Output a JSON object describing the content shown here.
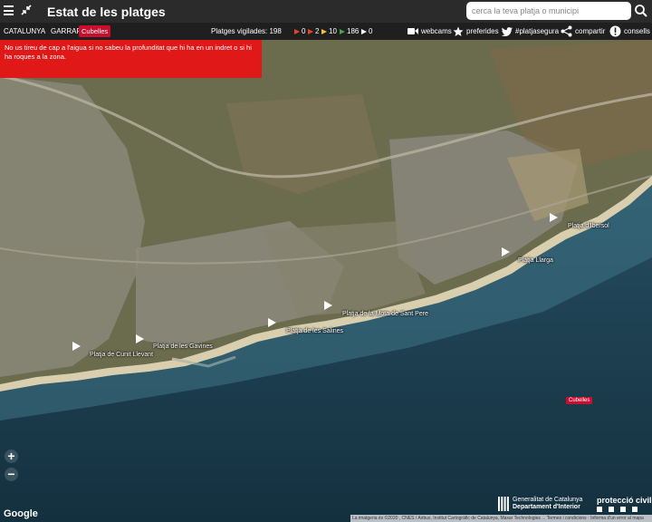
{
  "header": {
    "title": "Estat de les platges",
    "search_placeholder": "cerca la teva platja o municipi"
  },
  "breadcrumb": {
    "region": "CATALUNYA",
    "county": "GARRAF",
    "town": "Cubelles"
  },
  "status": {
    "monitored_label": "Platges vigilades: 198",
    "flags": [
      {
        "color": "#e8452b",
        "count": "0"
      },
      {
        "color": "#e8452b",
        "count": "2"
      },
      {
        "color": "#f2c12e",
        "count": "10"
      },
      {
        "color": "#3fa847",
        "count": "186"
      },
      {
        "color": "#ffffff",
        "count": "0"
      }
    ]
  },
  "tools": {
    "webcams": "webcams",
    "favorites": "preferides",
    "hashtag": "#platjasegura",
    "share": "compartir",
    "tips": "consells"
  },
  "alert": {
    "message": "No us tireu de cap a l'aigua si no sabeu la profunditat que hi ha en un indret o si hi ha roques a la zona."
  },
  "beaches": [
    {
      "name": "Platja d'Ibersol"
    },
    {
      "name": "Platja Llarga"
    },
    {
      "name": "Platja de la Mota de Sant Pere"
    },
    {
      "name": "Platja de les Salines"
    },
    {
      "name": "Platja de les Gavines"
    },
    {
      "name": "Platja de Cunit Llevant"
    }
  ],
  "map": {
    "town_label": "Cubelles",
    "zoom_in": "+",
    "zoom_out": "−",
    "provider": "Google",
    "attribution": "La imatgeria és ©2020 , CNES / Airbus, Institut Cartogràfic de Catalunya, Maxar Technologies ... Termes i condicions · Informa d'un error al mapa"
  },
  "footer": {
    "gov_line1": "Generalitat de Catalunya",
    "gov_line2": "Departament d'Interior",
    "civil_protection": "protecció civil"
  }
}
